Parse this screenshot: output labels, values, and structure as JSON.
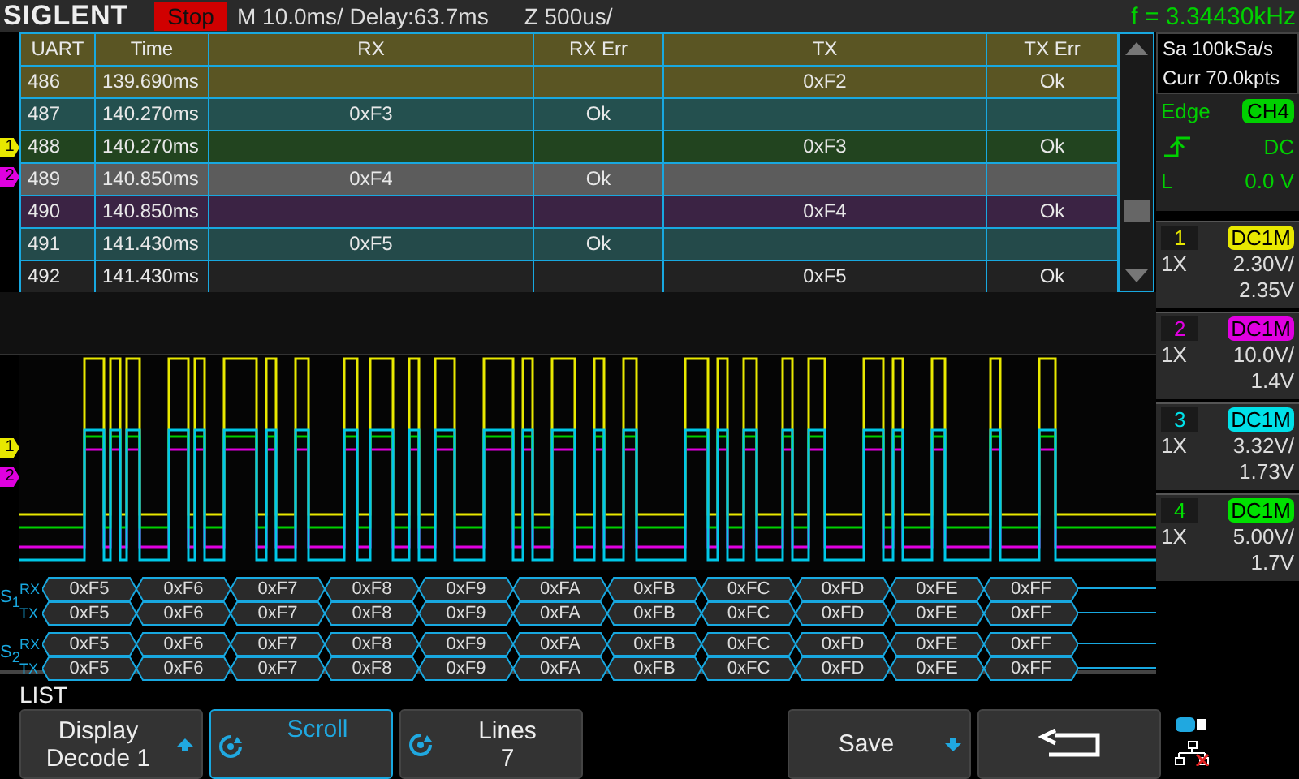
{
  "top_bar": {
    "logo": "SIGLENT",
    "run_state": "Stop",
    "timebase": "M 10.0ms/ Delay:63.7ms",
    "zoom": "Z 500us/",
    "frequency": "f = 3.34430kHz"
  },
  "table": {
    "columns": [
      "UART",
      "Time",
      "RX",
      "RX Err",
      "TX",
      "TX Err"
    ],
    "rows": [
      {
        "cells": [
          "486",
          "139.690ms",
          "",
          "",
          "0xF2",
          "Ok"
        ],
        "selected": false
      },
      {
        "cells": [
          "487",
          "140.270ms",
          "0xF3",
          "Ok",
          "",
          ""
        ],
        "selected": false
      },
      {
        "cells": [
          "488",
          "140.270ms",
          "",
          "",
          "0xF3",
          "Ok"
        ],
        "selected": false
      },
      {
        "cells": [
          "489",
          "140.850ms",
          "0xF4",
          "Ok",
          "",
          ""
        ],
        "selected": true
      },
      {
        "cells": [
          "490",
          "140.850ms",
          "",
          "",
          "0xF4",
          "Ok"
        ],
        "selected": false
      },
      {
        "cells": [
          "491",
          "141.430ms",
          "0xF5",
          "Ok",
          "",
          ""
        ],
        "selected": false
      },
      {
        "cells": [
          "492",
          "141.430ms",
          "",
          "",
          "0xF5",
          "Ok"
        ],
        "selected": false
      }
    ],
    "markers": [
      {
        "label": "1",
        "color": "#e8e800"
      },
      {
        "label": "2",
        "color": "#e000e0"
      }
    ]
  },
  "waveform_markers": [
    {
      "label": "1",
      "color": "#e8e800"
    },
    {
      "label": "2",
      "color": "#e000e0"
    }
  ],
  "decode_buses": [
    {
      "label": "S$_{1}$",
      "lines": [
        {
          "name": "RX",
          "values": [
            "0xF5",
            "0xF6",
            "0xF7",
            "0xF8",
            "0xF9",
            "0xFA",
            "0xFB",
            "0xFC",
            "0xFD",
            "0xFE",
            "0xFF"
          ]
        },
        {
          "name": "TX",
          "values": [
            "0xF5",
            "0xF6",
            "0xF7",
            "0xF8",
            "0xF9",
            "0xFA",
            "0xFB",
            "0xFC",
            "0xFD",
            "0xFE",
            "0xFF"
          ]
        }
      ]
    },
    {
      "label": "S$_{2}$",
      "lines": [
        {
          "name": "RX",
          "values": [
            "0xF5",
            "0xF6",
            "0xF7",
            "0xF8",
            "0xF9",
            "0xFA",
            "0xFB",
            "0xFC",
            "0xFD",
            "0xFE",
            "0xFF"
          ]
        },
        {
          "name": "TX",
          "values": [
            "0xF5",
            "0xF6",
            "0xF7",
            "0xF8",
            "0xF9",
            "0xFA",
            "0xFB",
            "0xFC",
            "0xFD",
            "0xFE",
            "0xFF"
          ]
        }
      ]
    }
  ],
  "acquisition": {
    "sample_rate": "Sa 100kSa/s",
    "memory": "Curr 70.0kpts"
  },
  "trigger": {
    "type": "Edge",
    "source": "CH4",
    "coupling": "DC",
    "level_label": "L",
    "level": "0.0 V"
  },
  "channels": [
    {
      "number": "1",
      "coupling": "DC1M",
      "probe": "1X",
      "scale": "2.30V/",
      "offset": "2.35V",
      "color": "#e8e800"
    },
    {
      "number": "2",
      "coupling": "DC1M",
      "probe": "1X",
      "scale": "10.0V/",
      "offset": "1.4V",
      "color": "#e000e0"
    },
    {
      "number": "3",
      "coupling": "DC1M",
      "probe": "1X",
      "scale": "3.32V/",
      "offset": "1.73V",
      "color": "#00e0e8"
    },
    {
      "number": "4",
      "coupling": "DC1M",
      "probe": "1X",
      "scale": "5.00V/",
      "offset": "1.7V",
      "color": "#00e000"
    }
  ],
  "menu": {
    "title": "LIST",
    "buttons": [
      {
        "kind": "up",
        "lines": [
          "Display",
          "Decode 1"
        ],
        "selected": false
      },
      {
        "kind": "knob",
        "lines": [
          "Scroll"
        ],
        "selected": true
      },
      {
        "kind": "knob",
        "lines": [
          "Lines",
          "7"
        ],
        "selected": false
      },
      {
        "kind": "gap"
      },
      {
        "kind": "down",
        "lines": [
          "Save"
        ],
        "selected": false
      },
      {
        "kind": "back",
        "selected": false
      }
    ]
  }
}
